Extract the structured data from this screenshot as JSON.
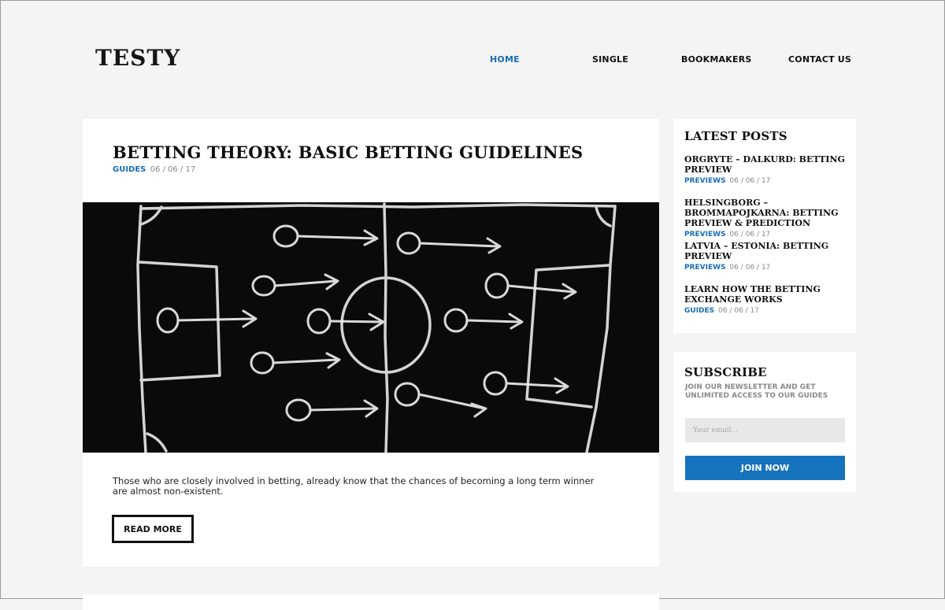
{
  "header": {
    "logo": "TESTY",
    "nav": [
      {
        "label": "HOME",
        "active": true
      },
      {
        "label": "SINGLE",
        "active": false
      },
      {
        "label": "BOOKMAKERS",
        "active": false
      },
      {
        "label": "CONTACT US",
        "active": false
      }
    ]
  },
  "post": {
    "title": "BETTING THEORY: BASIC BETTING GUIDELINES",
    "category": "GUIDES",
    "date": "06 / 06 / 17",
    "excerpt": "Those who are closely involved in betting, already know that the chances of becoming a long term winner are almost non-existent.",
    "read_more": "READ MORE"
  },
  "latest_posts": {
    "title": "LATEST POSTS",
    "items": [
      {
        "title": "ORGRYTE – DALKURD: BETTING PREVIEW",
        "category": "PREVIEWS",
        "date": "06 / 06 / 17"
      },
      {
        "title": "HELSINGBORG – BROMMAPOJKARNA: BETTING PREVIEW & PREDICTION",
        "category": "PREVIEWS",
        "date": "06 / 06 / 17"
      },
      {
        "title": "LATVIA – ESTONIA: BETTING PREVIEW",
        "category": "PREVIEWS",
        "date": "06 / 06 / 17"
      },
      {
        "title": "LEARN HOW THE BETTING EXCHANGE WORKS",
        "category": "GUIDES",
        "date": "06 / 06 / 17"
      }
    ]
  },
  "subscribe": {
    "title": "SUBSCRIBE",
    "description": "JOIN OUR NEWSLETTER AND GET UNLIMITED ACCESS TO OUR GUIDES",
    "placeholder": "Your email...",
    "button": "JOIN NOW"
  },
  "colors": {
    "accent": "#1a6db5",
    "button": "#1673bd",
    "background": "#f3f4f3"
  }
}
